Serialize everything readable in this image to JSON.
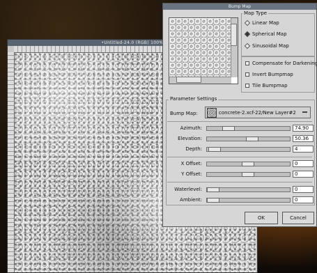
{
  "image_window": {
    "title": "•Untitled-24.0 (RGB) 100%"
  },
  "dialog": {
    "title": "Bump Map",
    "map_type": {
      "label": "Map Type",
      "options": [
        {
          "label": "Linear Map",
          "selected": false
        },
        {
          "label": "Spherical Map",
          "selected": true
        },
        {
          "label": "Sinusoidal Map",
          "selected": false
        }
      ]
    },
    "checks": [
      {
        "label": "Compensate for Darkening"
      },
      {
        "label": "Invert Bumpmap"
      },
      {
        "label": "Tile Bumpmap"
      }
    ],
    "params": {
      "label": "Parameter Settings",
      "bump_map_label": "Bump Map:",
      "bump_map_value": "concrete-2.xcf-22/New Layer#2",
      "sliders": [
        {
          "label": "Azimuth:",
          "value": "74.90"
        },
        {
          "label": "Elevation:",
          "value": "50.36"
        },
        {
          "label": "Depth:",
          "value": "4"
        },
        {
          "label": "X Offset:",
          "value": "0"
        },
        {
          "label": "Y Offset:",
          "value": "0"
        },
        {
          "label": "Waterlevel:",
          "value": "0"
        },
        {
          "label": "Ambient:",
          "value": "0"
        }
      ]
    },
    "ok_label": "OK",
    "cancel_label": "Cancel"
  }
}
